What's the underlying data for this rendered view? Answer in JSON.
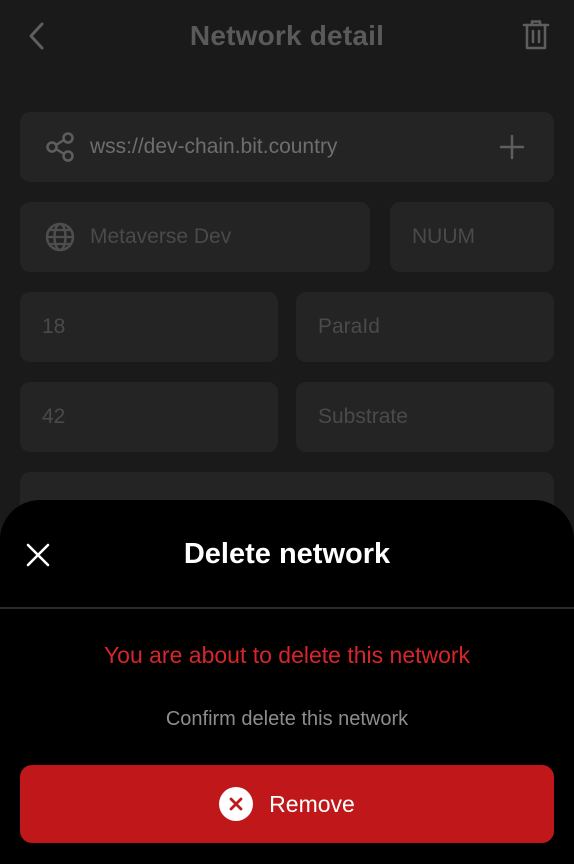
{
  "header": {
    "title": "Network detail",
    "back_icon": "chevron-left-icon",
    "delete_icon": "trash-icon"
  },
  "form": {
    "provider_url": "wss://dev-chain.bit.country",
    "network_name": "Metaverse Dev",
    "symbol": "NUUM",
    "decimals": "18",
    "para_id": "ParaId",
    "ss58_prefix": "42",
    "network_type": "Substrate"
  },
  "sheet": {
    "title": "Delete network",
    "warning": "You are about to delete this network",
    "confirm": "Confirm delete this network",
    "remove_label": "Remove"
  },
  "colors": {
    "danger": "#c0171b",
    "warning_text": "#d7262b",
    "sheet_bg": "#000000",
    "page_bg": "#1a1a1a"
  }
}
